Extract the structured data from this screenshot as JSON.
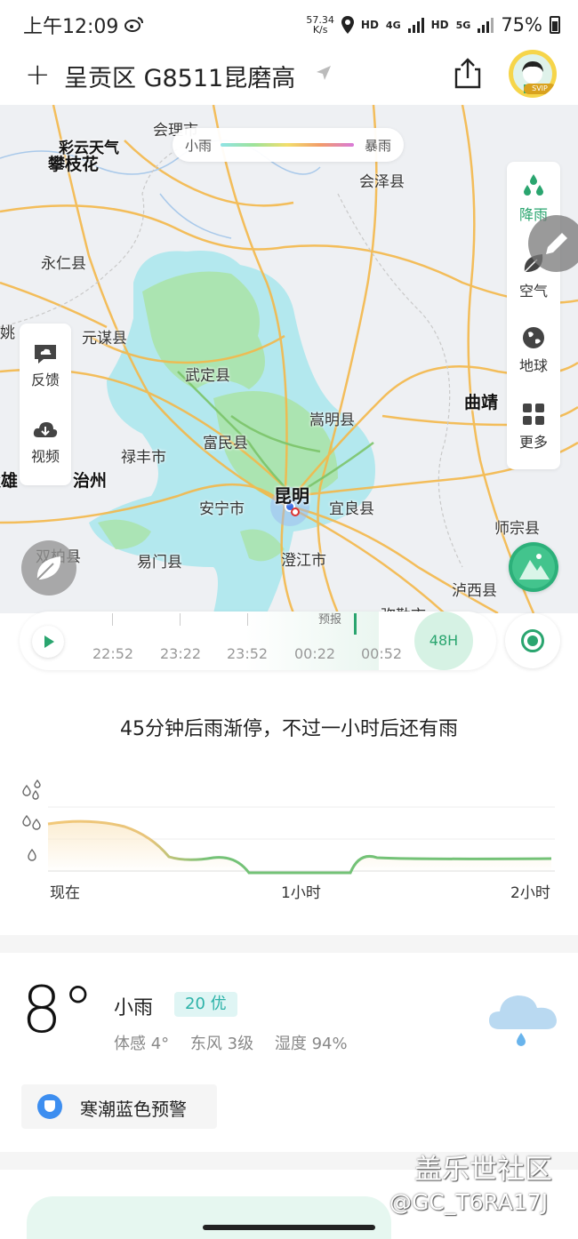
{
  "status_bar": {
    "time": "上午12:09",
    "net_speed_value": "57.34",
    "net_speed_unit": "K/s",
    "hd1": "HD",
    "net4g": "4G",
    "hd2": "HD",
    "net5g": "5G",
    "battery": "75%"
  },
  "header": {
    "location": "呈贡区 G8511昆磨高",
    "avatar_badge": "SVIP"
  },
  "map": {
    "legend_min": "小雨",
    "legend_max": "暴雨",
    "labels": [
      {
        "text": "会理市",
        "cls": ""
      },
      {
        "text": "彩云天气",
        "cls": "big"
      },
      {
        "text": "攀枝花",
        "cls": "big"
      },
      {
        "text": "会泽县",
        "cls": ""
      },
      {
        "text": "永仁县",
        "cls": ""
      },
      {
        "text": "姚",
        "cls": ""
      },
      {
        "text": "元谋县",
        "cls": ""
      },
      {
        "text": "武定县",
        "cls": ""
      },
      {
        "text": "曲靖",
        "cls": "big"
      },
      {
        "text": "嵩明县",
        "cls": ""
      },
      {
        "text": "富民县",
        "cls": ""
      },
      {
        "text": "禄丰市",
        "cls": ""
      },
      {
        "text": "楚雄",
        "cls": "big"
      },
      {
        "text": "治州",
        "cls": "big"
      },
      {
        "text": "昆明",
        "cls": "city"
      },
      {
        "text": "安宁市",
        "cls": ""
      },
      {
        "text": "宜良县",
        "cls": ""
      },
      {
        "text": "师宗县",
        "cls": ""
      },
      {
        "text": "双柏县",
        "cls": ""
      },
      {
        "text": "易门县",
        "cls": ""
      },
      {
        "text": "澄江市",
        "cls": ""
      },
      {
        "text": "泸西县",
        "cls": ""
      },
      {
        "text": "弥勒市",
        "cls": ""
      }
    ],
    "side_menu": {
      "rain": "降雨",
      "air": "空气",
      "earth": "地球",
      "more": "更多"
    },
    "left_menu": {
      "feedback": "反馈",
      "video": "视频"
    }
  },
  "timeline": {
    "forecast_label": "预报",
    "times": [
      "22:52",
      "23:22",
      "23:52",
      "00:22",
      "00:52"
    ],
    "range_button": "48H"
  },
  "forecast": {
    "summary": "45分钟后雨渐停，不过一小时后还有雨",
    "x_labels": [
      "现在",
      "1小时",
      "2小时"
    ]
  },
  "current": {
    "temperature": "8°",
    "condition": "小雨",
    "aqi": "20 优",
    "feels_like": "体感 4°",
    "wind": "东风 3级",
    "humidity": "湿度 94%",
    "alert": "寒潮蓝色预警"
  },
  "watermark": {
    "line1": "盖乐世社区",
    "line2": "@GC_T6RA17J"
  },
  "colors": {
    "accent": "#2aa56f",
    "aqi_text": "#2cb2a8",
    "alert_icon": "#3d8ef0"
  }
}
